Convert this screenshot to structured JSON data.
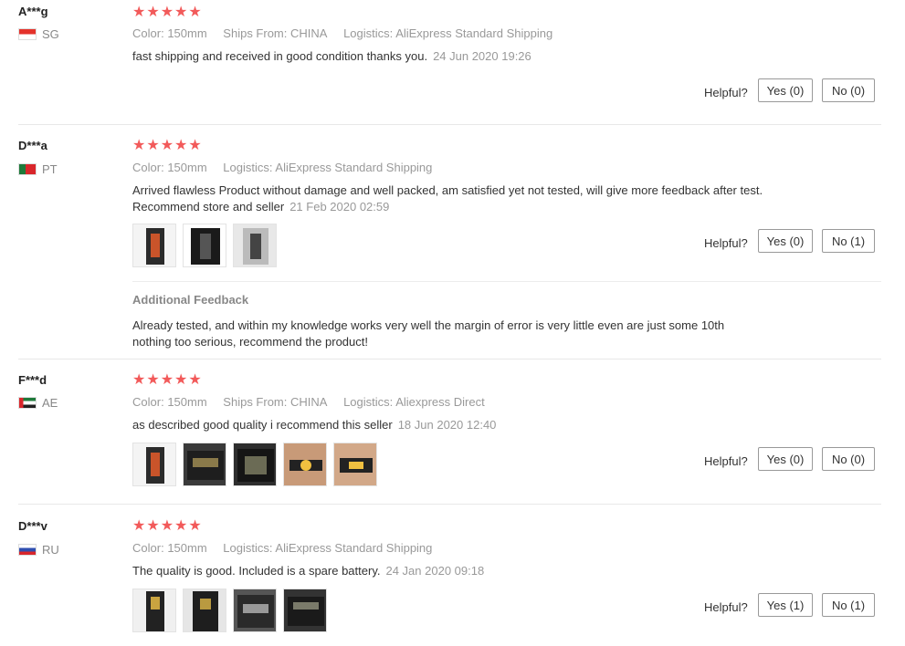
{
  "reviews": [
    {
      "user": "A***g",
      "country": "SG",
      "stars": "★★★★★",
      "color_label": "Color:",
      "color_value": "150mm",
      "ships_label": "Ships From:",
      "ships_value": "CHINA",
      "logistics_label": "Logistics:",
      "logistics_value": "AliExpress Standard Shipping",
      "text": "fast shipping and received in good condition thanks you.",
      "date": "24 Jun 2020 19:26",
      "helpful": "Helpful?",
      "yes": "Yes (0)",
      "no": "No (0)"
    },
    {
      "user": "D***a",
      "country": "PT",
      "stars": "★★★★★",
      "color_label": "Color:",
      "color_value": "150mm",
      "logistics_label": "Logistics:",
      "logistics_value": "AliExpress Standard Shipping",
      "text": "Arrived flawless Product without damage and well packed, am satisfied yet not tested, will give more feedback after test. Recommend store and seller",
      "date": "21 Feb 2020 02:59",
      "helpful": "Helpful?",
      "yes": "Yes (0)",
      "no": "No (1)",
      "additional_title": "Additional Feedback",
      "additional_text": "Already tested, and within my knowledge works very well the margin of error is very little even are just some 10th nothing too serious, recommend the product!"
    },
    {
      "user": "F***d",
      "country": "AE",
      "stars": "★★★★★",
      "color_label": "Color:",
      "color_value": "150mm",
      "ships_label": "Ships From:",
      "ships_value": "CHINA",
      "logistics_label": "Logistics:",
      "logistics_value": "Aliexpress Direct",
      "text": "as described good quality i recommend this seller",
      "date": "18 Jun 2020 12:40",
      "helpful": "Helpful?",
      "yes": "Yes (0)",
      "no": "No (0)"
    },
    {
      "user": "D***v",
      "country": "RU",
      "stars": "★★★★★",
      "color_label": "Color:",
      "color_value": "150mm",
      "logistics_label": "Logistics:",
      "logistics_value": "AliExpress Standard Shipping",
      "text": "The quality is good. Included is a spare battery.",
      "date": "24 Jan 2020 09:18",
      "helpful": "Helpful?",
      "yes": "Yes (1)",
      "no": "No (1)"
    }
  ],
  "colors": {
    "star": "#f25a5a",
    "border": "#e8e8e8",
    "muted": "#999999"
  }
}
